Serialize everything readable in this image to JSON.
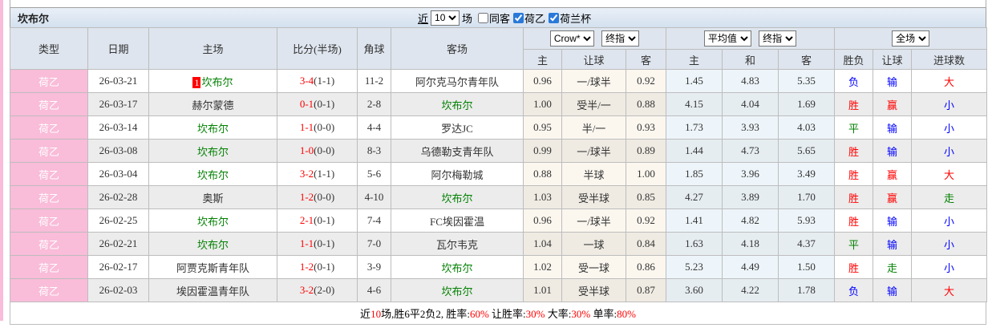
{
  "title": "坎布尔",
  "controls": {
    "near": "近",
    "count": "10",
    "games": "场",
    "checkboxes": [
      {
        "label": "同客",
        "checked": false
      },
      {
        "label": "荷乙",
        "checked": true
      },
      {
        "label": "荷兰杯",
        "checked": true
      }
    ]
  },
  "header": {
    "type": "类型",
    "date": "日期",
    "home": "主场",
    "score": "比分(半场)",
    "corner": "角球",
    "away": "客场",
    "odds_company": "Crow*",
    "odds_time": "终指",
    "avg_company": "平均值",
    "avg_time": "终指",
    "scope": "全场",
    "odds_cols": [
      "主",
      "让球",
      "客"
    ],
    "avg_cols": [
      "主",
      "和",
      "客"
    ],
    "result_cols": [
      "胜负",
      "让球",
      "进球数"
    ]
  },
  "colors": {
    "red": "#ff0000",
    "blue": "#0000ff",
    "green": "#008000",
    "pink": "#f9bcd9"
  },
  "rows": [
    {
      "type": "荷乙",
      "date": "26-03-21",
      "home": {
        "rank": "1",
        "name": "坎布尔",
        "green": true
      },
      "score_ft": "3-4",
      "score_ht": "(1-1)",
      "corner": "11-2",
      "away": {
        "name": "阿尔克马尔青年队",
        "green": false
      },
      "odds": [
        "0.96",
        "一/球半",
        "0.92"
      ],
      "avg": [
        "1.45",
        "4.83",
        "5.35"
      ],
      "results": [
        {
          "text": "负",
          "color": "blue"
        },
        {
          "text": "输",
          "color": "blue"
        },
        {
          "text": "大",
          "color": "red"
        }
      ]
    },
    {
      "type": "荷乙",
      "date": "26-03-17",
      "home": {
        "name": "赫尔蒙德",
        "green": false
      },
      "score_ft": "0-1",
      "score_ht": "(0-1)",
      "corner": "2-8",
      "away": {
        "name": "坎布尔",
        "green": true
      },
      "odds": [
        "1.00",
        "受半/一",
        "0.88"
      ],
      "avg": [
        "4.15",
        "4.04",
        "1.69"
      ],
      "results": [
        {
          "text": "胜",
          "color": "red"
        },
        {
          "text": "赢",
          "color": "red"
        },
        {
          "text": "小",
          "color": "blue"
        }
      ]
    },
    {
      "type": "荷乙",
      "date": "26-03-14",
      "home": {
        "name": "坎布尔",
        "green": true
      },
      "score_ft": "1-1",
      "score_ht": "(0-0)",
      "corner": "4-4",
      "away": {
        "name": "罗达JC",
        "green": false
      },
      "odds": [
        "0.95",
        "半/一",
        "0.93"
      ],
      "avg": [
        "1.73",
        "3.93",
        "4.03"
      ],
      "results": [
        {
          "text": "平",
          "color": "green"
        },
        {
          "text": "输",
          "color": "blue"
        },
        {
          "text": "小",
          "color": "blue"
        }
      ]
    },
    {
      "type": "荷乙",
      "date": "26-03-08",
      "home": {
        "name": "坎布尔",
        "green": true
      },
      "score_ft": "1-0",
      "score_ht": "(0-0)",
      "corner": "8-3",
      "away": {
        "name": "乌德勒支青年队",
        "green": false
      },
      "odds": [
        "0.99",
        "一/球半",
        "0.89"
      ],
      "avg": [
        "1.44",
        "4.73",
        "5.65"
      ],
      "results": [
        {
          "text": "胜",
          "color": "red"
        },
        {
          "text": "输",
          "color": "blue"
        },
        {
          "text": "小",
          "color": "blue"
        }
      ]
    },
    {
      "type": "荷乙",
      "date": "26-03-04",
      "home": {
        "name": "坎布尔",
        "green": true
      },
      "score_ft": "3-2",
      "score_ht": "(1-1)",
      "corner": "5-6",
      "away": {
        "name": "阿尔梅勒城",
        "green": false
      },
      "odds": [
        "0.88",
        "半球",
        "1.00"
      ],
      "avg": [
        "1.85",
        "3.96",
        "3.49"
      ],
      "results": [
        {
          "text": "胜",
          "color": "red"
        },
        {
          "text": "赢",
          "color": "red"
        },
        {
          "text": "大",
          "color": "red"
        }
      ]
    },
    {
      "type": "荷乙",
      "date": "26-02-28",
      "home": {
        "name": "奥斯",
        "green": false
      },
      "score_ft": "1-2",
      "score_ht": "(0-0)",
      "corner": "4-10",
      "away": {
        "name": "坎布尔",
        "green": true
      },
      "odds": [
        "1.03",
        "受半球",
        "0.85"
      ],
      "avg": [
        "4.27",
        "3.89",
        "1.70"
      ],
      "results": [
        {
          "text": "胜",
          "color": "red"
        },
        {
          "text": "赢",
          "color": "red"
        },
        {
          "text": "走",
          "color": "green"
        }
      ]
    },
    {
      "type": "荷乙",
      "date": "26-02-25",
      "home": {
        "name": "坎布尔",
        "green": true
      },
      "score_ft": "2-1",
      "score_ht": "(0-1)",
      "corner": "7-4",
      "away": {
        "name": "FC埃因霍温",
        "green": false
      },
      "odds": [
        "0.96",
        "一/球半",
        "0.92"
      ],
      "avg": [
        "1.41",
        "4.82",
        "5.93"
      ],
      "results": [
        {
          "text": "胜",
          "color": "red"
        },
        {
          "text": "输",
          "color": "blue"
        },
        {
          "text": "小",
          "color": "blue"
        }
      ]
    },
    {
      "type": "荷乙",
      "date": "26-02-21",
      "home": {
        "name": "坎布尔",
        "green": true
      },
      "score_ft": "1-1",
      "score_ht": "(0-1)",
      "corner": "7-0",
      "away": {
        "name": "瓦尔韦克",
        "green": false
      },
      "odds": [
        "1.04",
        "一球",
        "0.84"
      ],
      "avg": [
        "1.63",
        "4.18",
        "4.37"
      ],
      "results": [
        {
          "text": "平",
          "color": "green"
        },
        {
          "text": "输",
          "color": "blue"
        },
        {
          "text": "小",
          "color": "blue"
        }
      ]
    },
    {
      "type": "荷乙",
      "date": "26-02-17",
      "home": {
        "name": "阿贾克斯青年队",
        "green": false
      },
      "score_ft": "1-2",
      "score_ht": "(0-1)",
      "corner": "3-9",
      "away": {
        "name": "坎布尔",
        "green": true
      },
      "odds": [
        "1.02",
        "受一球",
        "0.86"
      ],
      "avg": [
        "5.23",
        "4.49",
        "1.50"
      ],
      "results": [
        {
          "text": "胜",
          "color": "red"
        },
        {
          "text": "走",
          "color": "green"
        },
        {
          "text": "小",
          "color": "blue"
        }
      ]
    },
    {
      "type": "荷乙",
      "date": "26-02-03",
      "home": {
        "name": "埃因霍温青年队",
        "green": false
      },
      "score_ft": "3-2",
      "score_ht": "(2-0)",
      "corner": "4-6",
      "away": {
        "name": "坎布尔",
        "green": true
      },
      "odds": [
        "1.01",
        "受半球",
        "0.87"
      ],
      "avg": [
        "3.60",
        "4.22",
        "1.78"
      ],
      "results": [
        {
          "text": "负",
          "color": "blue"
        },
        {
          "text": "输",
          "color": "blue"
        },
        {
          "text": "大",
          "color": "red"
        }
      ]
    }
  ],
  "footer": {
    "segments": [
      {
        "text": "近"
      },
      {
        "text": "10",
        "red": true
      },
      {
        "text": "场,胜6平2负2, 胜率:"
      },
      {
        "text": "60%",
        "red": true
      },
      {
        "text": " 让胜率:"
      },
      {
        "text": "30%",
        "red": true
      },
      {
        "text": " 大率:"
      },
      {
        "text": "30%",
        "red": true
      },
      {
        "text": " 单率:"
      },
      {
        "text": "80%",
        "red": true
      }
    ]
  }
}
